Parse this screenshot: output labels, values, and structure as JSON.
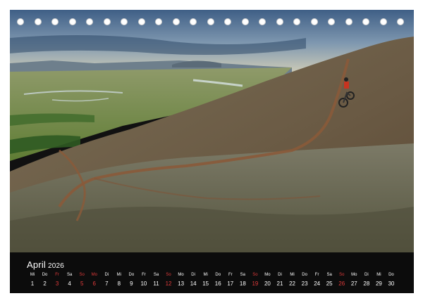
{
  "calendar": {
    "month": "April",
    "year": "2026",
    "days": [
      {
        "dn": "Mi",
        "d": "1",
        "type": "normal"
      },
      {
        "dn": "Do",
        "d": "2",
        "type": "normal"
      },
      {
        "dn": "Fr",
        "d": "3",
        "type": "holiday"
      },
      {
        "dn": "Sa",
        "d": "4",
        "type": "normal"
      },
      {
        "dn": "So",
        "d": "5",
        "type": "sunday"
      },
      {
        "dn": "Mo",
        "d": "6",
        "type": "holiday"
      },
      {
        "dn": "Di",
        "d": "7",
        "type": "normal"
      },
      {
        "dn": "Mi",
        "d": "8",
        "type": "normal"
      },
      {
        "dn": "Do",
        "d": "9",
        "type": "normal"
      },
      {
        "dn": "Fr",
        "d": "10",
        "type": "normal"
      },
      {
        "dn": "Sa",
        "d": "11",
        "type": "normal"
      },
      {
        "dn": "So",
        "d": "12",
        "type": "sunday"
      },
      {
        "dn": "Mo",
        "d": "13",
        "type": "normal"
      },
      {
        "dn": "Di",
        "d": "14",
        "type": "normal"
      },
      {
        "dn": "Mi",
        "d": "15",
        "type": "normal"
      },
      {
        "dn": "Do",
        "d": "16",
        "type": "normal"
      },
      {
        "dn": "Fr",
        "d": "17",
        "type": "normal"
      },
      {
        "dn": "Sa",
        "d": "18",
        "type": "normal"
      },
      {
        "dn": "So",
        "d": "19",
        "type": "sunday"
      },
      {
        "dn": "Mo",
        "d": "20",
        "type": "normal"
      },
      {
        "dn": "Di",
        "d": "21",
        "type": "normal"
      },
      {
        "dn": "Mi",
        "d": "22",
        "type": "normal"
      },
      {
        "dn": "Do",
        "d": "23",
        "type": "normal"
      },
      {
        "dn": "Fr",
        "d": "24",
        "type": "normal"
      },
      {
        "dn": "Sa",
        "d": "25",
        "type": "normal"
      },
      {
        "dn": "So",
        "d": "26",
        "type": "sunday"
      },
      {
        "dn": "Mo",
        "d": "27",
        "type": "normal"
      },
      {
        "dn": "Di",
        "d": "28",
        "type": "normal"
      },
      {
        "dn": "Mi",
        "d": "29",
        "type": "normal"
      },
      {
        "dn": "Do",
        "d": "30",
        "type": "normal"
      }
    ]
  },
  "binding": {
    "ring_count": 23
  },
  "colors": {
    "holiday": "#e23b3b",
    "strip": "#0c0c0c",
    "text": "#ffffff"
  }
}
